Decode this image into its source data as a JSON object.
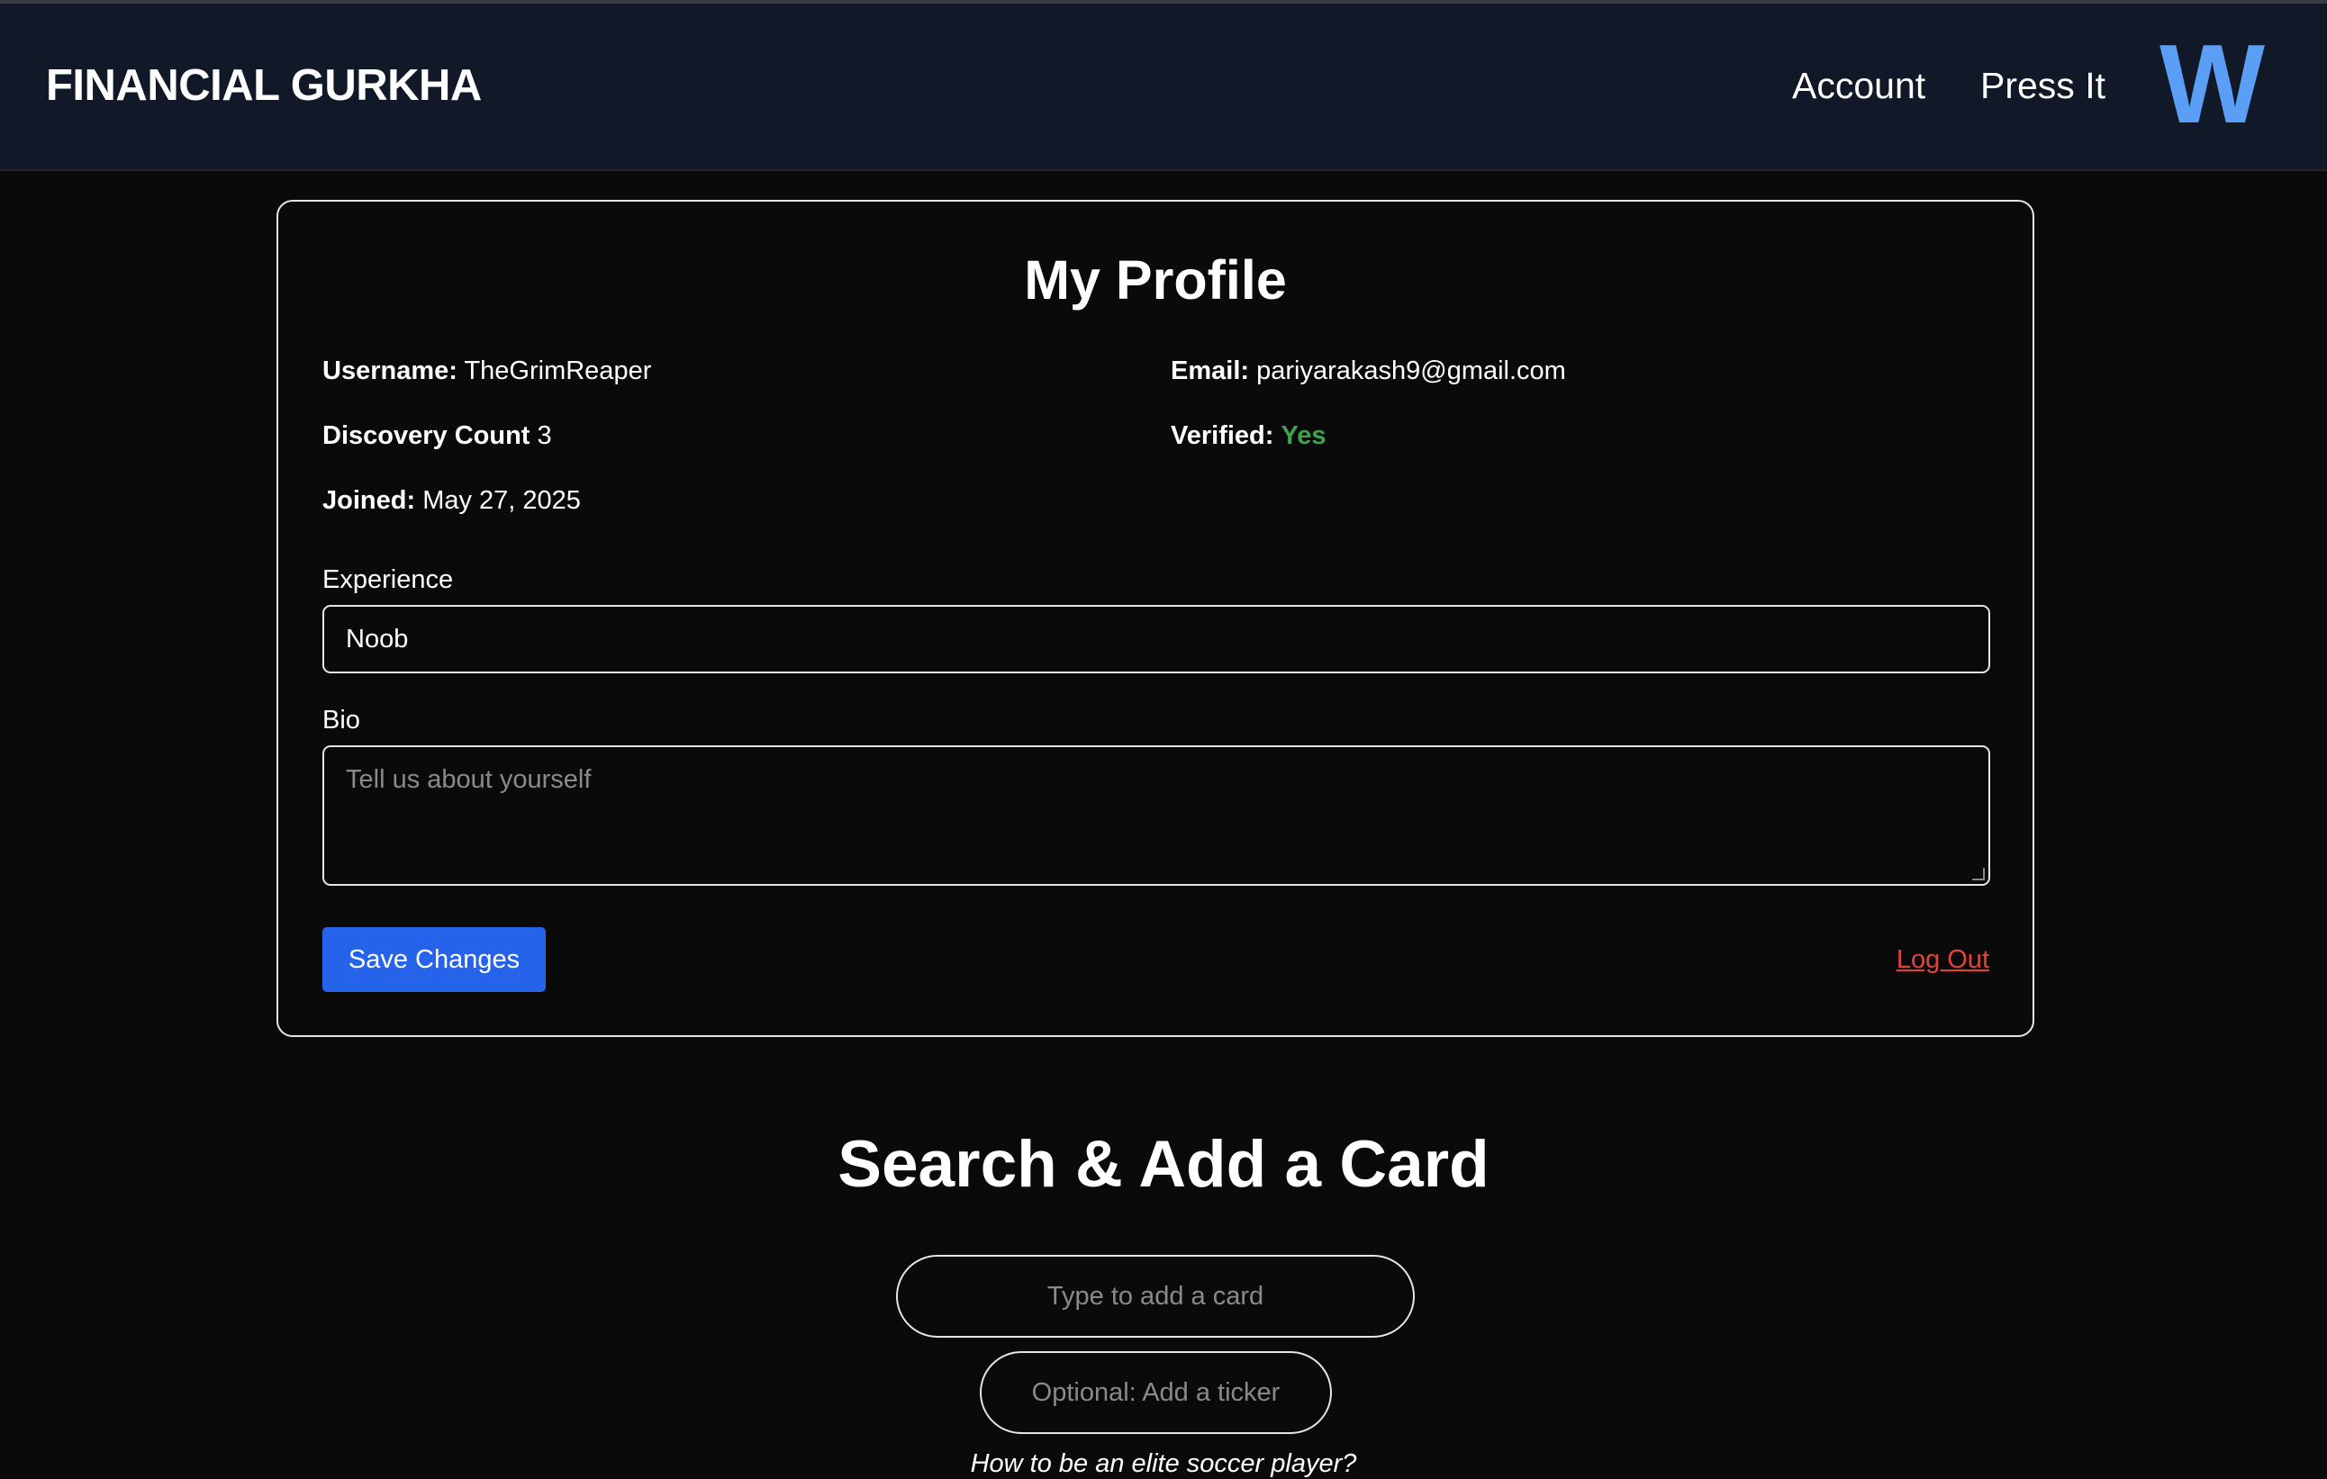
{
  "navbar": {
    "brand": "FINANCIAL GURKHA",
    "links": [
      "Account",
      "Press It"
    ],
    "logo_letter": "W"
  },
  "profile": {
    "title": "My Profile",
    "username_label": "Username:",
    "username_value": "TheGrimReaper",
    "email_label": "Email:",
    "email_value": "pariyarakash9@gmail.com",
    "discovery_label": "Discovery Count",
    "discovery_value": "3",
    "verified_label": "Verified:",
    "verified_value": "Yes",
    "joined_label": "Joined:",
    "joined_value": "May 27, 2025",
    "experience_label": "Experience",
    "experience_value": "Noob",
    "bio_label": "Bio",
    "bio_placeholder": "Tell us about yourself",
    "save_label": "Save Changes",
    "logout_label": "Log Out"
  },
  "search": {
    "title": "Search & Add a Card",
    "card_placeholder": "Type to add a card",
    "ticker_placeholder": "Optional: Add a ticker",
    "hint": "How to be an elite soccer player?"
  },
  "colors": {
    "navbar_bg": "#111827",
    "page_bg": "#0a0a0a",
    "accent_blue": "#2563eb",
    "logo_blue": "#5b9ef5",
    "verified_green": "#3fa34d",
    "logout_red": "#e4433c"
  }
}
